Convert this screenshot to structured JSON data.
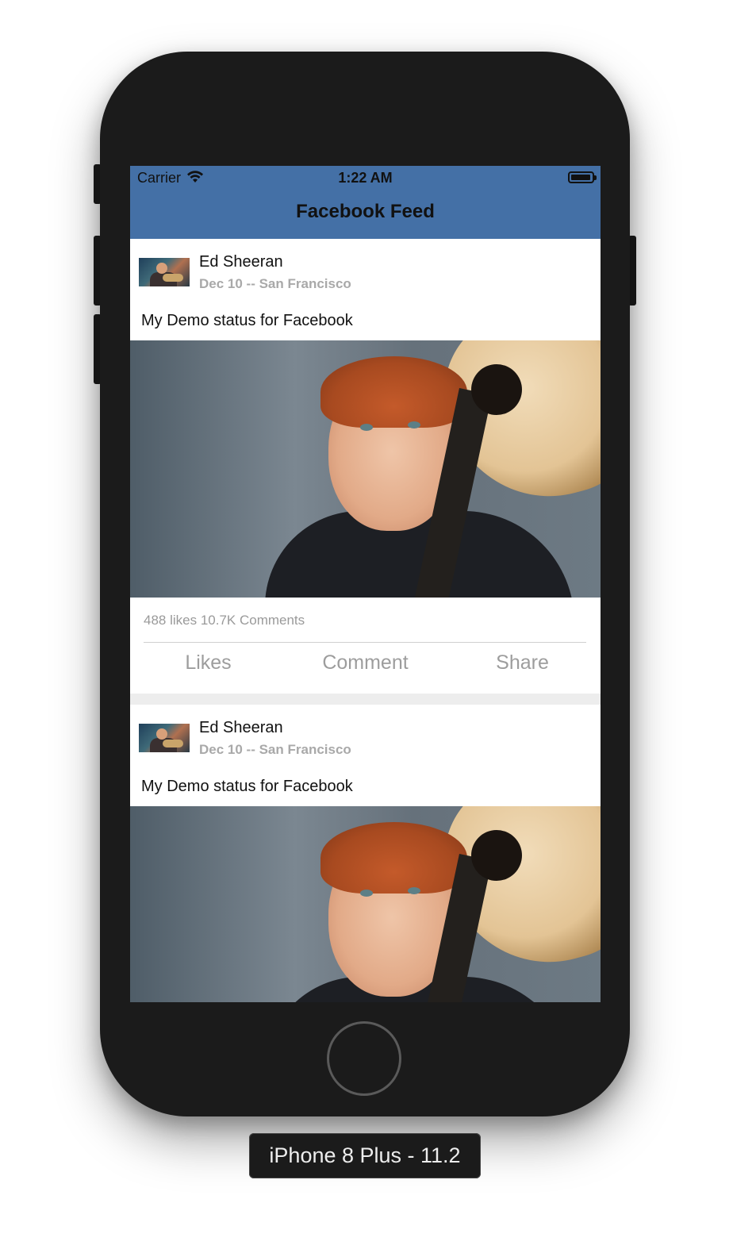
{
  "status_bar": {
    "carrier": "Carrier",
    "time": "1:22 AM"
  },
  "navbar": {
    "title": "Facebook Feed",
    "color": "#4470a6"
  },
  "posts": [
    {
      "name": "Ed Sheeran",
      "meta": "Dec 10 -- San Francisco",
      "status": "My Demo status for Facebook",
      "counts": "488 likes 10.7K Comments",
      "actions": {
        "like": "Likes",
        "comment": "Comment",
        "share": "Share"
      }
    },
    {
      "name": "Ed Sheeran",
      "meta": "Dec 10 -- San Francisco",
      "status": "My Demo status for Facebook"
    }
  ],
  "device": {
    "label": "iPhone 8 Plus - 11.2"
  },
  "icons": [
    "wifi-icon",
    "battery-icon"
  ]
}
